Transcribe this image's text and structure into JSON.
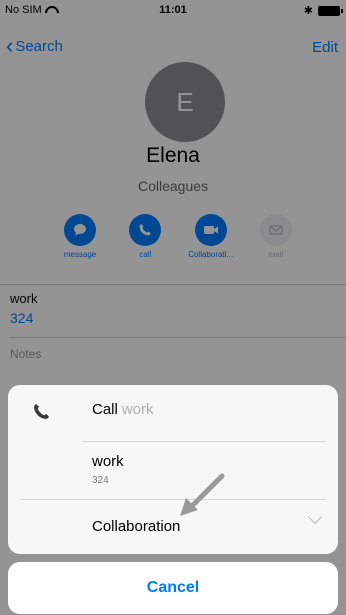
{
  "status_bar": {
    "carrier": "No SIM",
    "time": "11:01"
  },
  "nav": {
    "back_label": "Search",
    "edit_label": "Edit"
  },
  "contact": {
    "initial": "E",
    "name": "Elena",
    "group": "Colleagues"
  },
  "actions": [
    {
      "label": "message",
      "icon": "message-icon"
    },
    {
      "label": "call",
      "icon": "phone-icon"
    },
    {
      "label": "Collaborati...",
      "icon": "video-icon"
    },
    {
      "label": "mail",
      "icon": "mail-icon"
    }
  ],
  "phone_field": {
    "label": "work",
    "value": "324"
  },
  "notes_label": "Notes",
  "sheet": {
    "call_label": "Call",
    "call_sub": "work",
    "option1_title": "work",
    "option1_sub": "324",
    "option2_title": "Collaboration",
    "cancel_label": "Cancel"
  },
  "colors": {
    "accent": "#007aff",
    "avatar": "#8e8e93"
  }
}
